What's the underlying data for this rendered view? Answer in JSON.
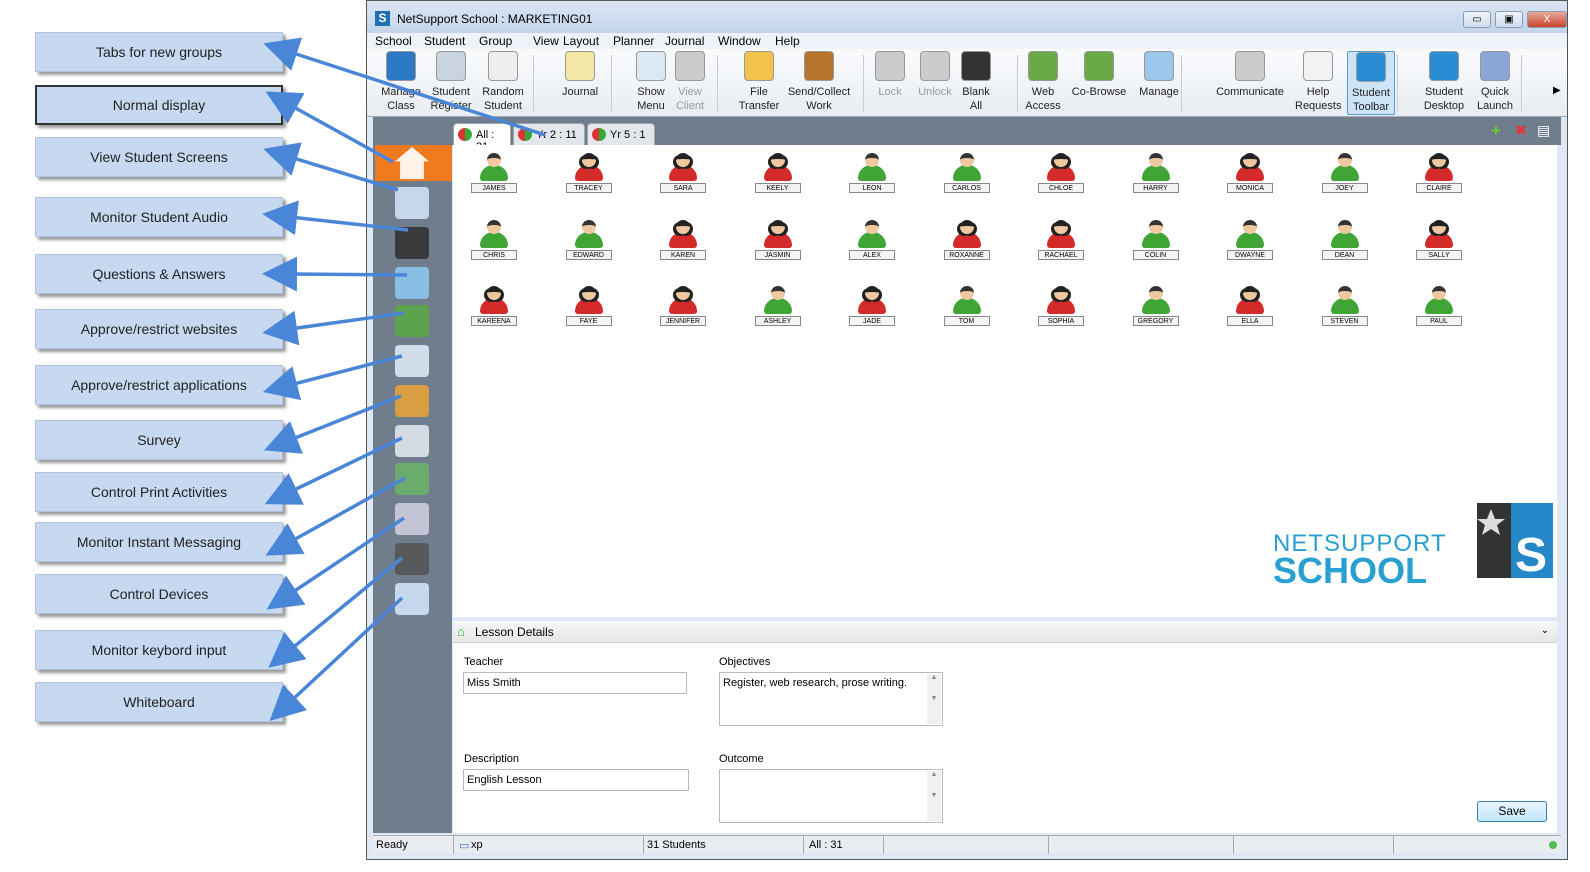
{
  "callouts": [
    "Tabs for new groups",
    "Normal display",
    "View Student Screens",
    "Monitor Student Audio",
    "Questions & Answers",
    "Approve/restrict websites",
    "Approve/restrict applications",
    "Survey",
    "Control Print Activities",
    "Monitor Instant Messaging",
    "Control Devices",
    "Monitor keybord input",
    "Whiteboard"
  ],
  "window": {
    "title": "NetSupport School : MARKETING01",
    "logo_letter": "S",
    "minimize": "▭",
    "maximize": "▣",
    "close": "X"
  },
  "menu": [
    "School",
    "Student",
    "Group",
    "View",
    "Layout",
    "Planner",
    "Journal",
    "Window",
    "Help"
  ],
  "toolbar": [
    {
      "l1": "Manage",
      "l2": "Class",
      "icon": "manage-class-icon",
      "state": "normal"
    },
    {
      "l1": "Student",
      "l2": "Register",
      "icon": "student-register-icon",
      "state": "normal"
    },
    {
      "l1": "Random",
      "l2": "Student",
      "icon": "dice-icon",
      "state": "normal"
    },
    {
      "l1": "Journal",
      "l2": "",
      "icon": "journal-icon",
      "state": "normal"
    },
    {
      "l1": "Show",
      "l2": "Menu",
      "icon": "projector-icon",
      "state": "normal"
    },
    {
      "l1": "View",
      "l2": "Client",
      "icon": "view-client-icon",
      "state": "disabled"
    },
    {
      "l1": "File",
      "l2": "Transfer",
      "icon": "folder-icon",
      "state": "normal"
    },
    {
      "l1": "Send/Collect",
      "l2": "Work",
      "icon": "briefcase-icon",
      "state": "normal"
    },
    {
      "l1": "Lock",
      "l2": "",
      "icon": "lock-icon",
      "state": "disabled"
    },
    {
      "l1": "Unlock",
      "l2": "",
      "icon": "unlock-icon",
      "state": "disabled"
    },
    {
      "l1": "Blank",
      "l2": "All",
      "icon": "monitor-icon",
      "state": "normal"
    },
    {
      "l1": "Web",
      "l2": "Access",
      "icon": "globe-lock-icon",
      "state": "normal"
    },
    {
      "l1": "Co-Browse",
      "l2": "",
      "icon": "globe-hand-icon",
      "state": "normal"
    },
    {
      "l1": "Manage",
      "l2": "",
      "icon": "computer-icon",
      "state": "normal"
    },
    {
      "l1": "Communicate",
      "l2": "",
      "icon": "chat-icon",
      "state": "normal"
    },
    {
      "l1": "Help",
      "l2": "Requests",
      "icon": "lifebuoy-icon",
      "state": "normal"
    },
    {
      "l1": "Student",
      "l2": "Toolbar",
      "icon": "student-toolbar-icon",
      "state": "active"
    },
    {
      "l1": "Student",
      "l2": "Desktop",
      "icon": "desktop-icon",
      "state": "normal"
    },
    {
      "l1": "Quick",
      "l2": "Launch",
      "icon": "rocket-icon",
      "state": "normal"
    }
  ],
  "tabs": [
    {
      "label": "All : 31",
      "active": true
    },
    {
      "label": "Yr 2 : 11",
      "active": false
    },
    {
      "label": "Yr 5 : 1",
      "active": false
    }
  ],
  "tab_actions": {
    "add": "+",
    "remove": "✖",
    "view": "▤"
  },
  "sidebar": [
    "home-icon",
    "view-screens-icon",
    "headphones-icon",
    "question-icon",
    "globe-icon",
    "applications-icon",
    "survey-pie-icon",
    "printer-icon",
    "messaging-icon",
    "devices-icon",
    "keyboard-icon",
    "whiteboard-icon"
  ],
  "students": [
    [
      "JAMES",
      "m"
    ],
    [
      "TRACEY",
      "f"
    ],
    [
      "SARA",
      "f"
    ],
    [
      "KEELY",
      "f"
    ],
    [
      "LEON",
      "m"
    ],
    [
      "CARLOS",
      "m"
    ],
    [
      "CHLOE",
      "f"
    ],
    [
      "HARRY",
      "m"
    ],
    [
      "MONICA",
      "f"
    ],
    [
      "JOEY",
      "m"
    ],
    [
      "CLAIRE",
      "f"
    ],
    [
      "CHRIS",
      "m"
    ],
    [
      "EDWARD",
      "m"
    ],
    [
      "KAREN",
      "f"
    ],
    [
      "JASMIN",
      "f"
    ],
    [
      "ALEX",
      "m"
    ],
    [
      "ROXANNE",
      "f"
    ],
    [
      "RACHAEL",
      "f"
    ],
    [
      "COLIN",
      "m"
    ],
    [
      "DWAYNE",
      "m"
    ],
    [
      "DEAN",
      "m"
    ],
    [
      "SALLY",
      "f"
    ],
    [
      "KAREENA",
      "f"
    ],
    [
      "FAYE",
      "f"
    ],
    [
      "JENNIFER",
      "f"
    ],
    [
      "ASHLEY",
      "m"
    ],
    [
      "JADE",
      "f"
    ],
    [
      "TOM",
      "m"
    ],
    [
      "SOPHIA",
      "f"
    ],
    [
      "GREGORY",
      "m"
    ],
    [
      "ELLA",
      "f"
    ],
    [
      "STEVEN",
      "m"
    ],
    [
      "PAUL",
      "m"
    ]
  ],
  "colors": {
    "male": "#3fa535",
    "female": "#d42a2a",
    "sidebar": "#6f7d8c",
    "accent": "#f07a20"
  },
  "brand": {
    "line1": "NETSUPPORT",
    "line2": "SCHOOL"
  },
  "lesson": {
    "header": "Lesson Details",
    "teacher_label": "Teacher",
    "teacher": "Miss Smith",
    "objectives_label": "Objectives",
    "objectives": "Register, web research, prose writing.",
    "description_label": "Description",
    "description": "English Lesson",
    "outcome_label": "Outcome",
    "outcome": "",
    "save": "Save"
  },
  "status": {
    "ready": "Ready",
    "machine": "xp",
    "students": "31 Students",
    "group": "All : 31"
  }
}
